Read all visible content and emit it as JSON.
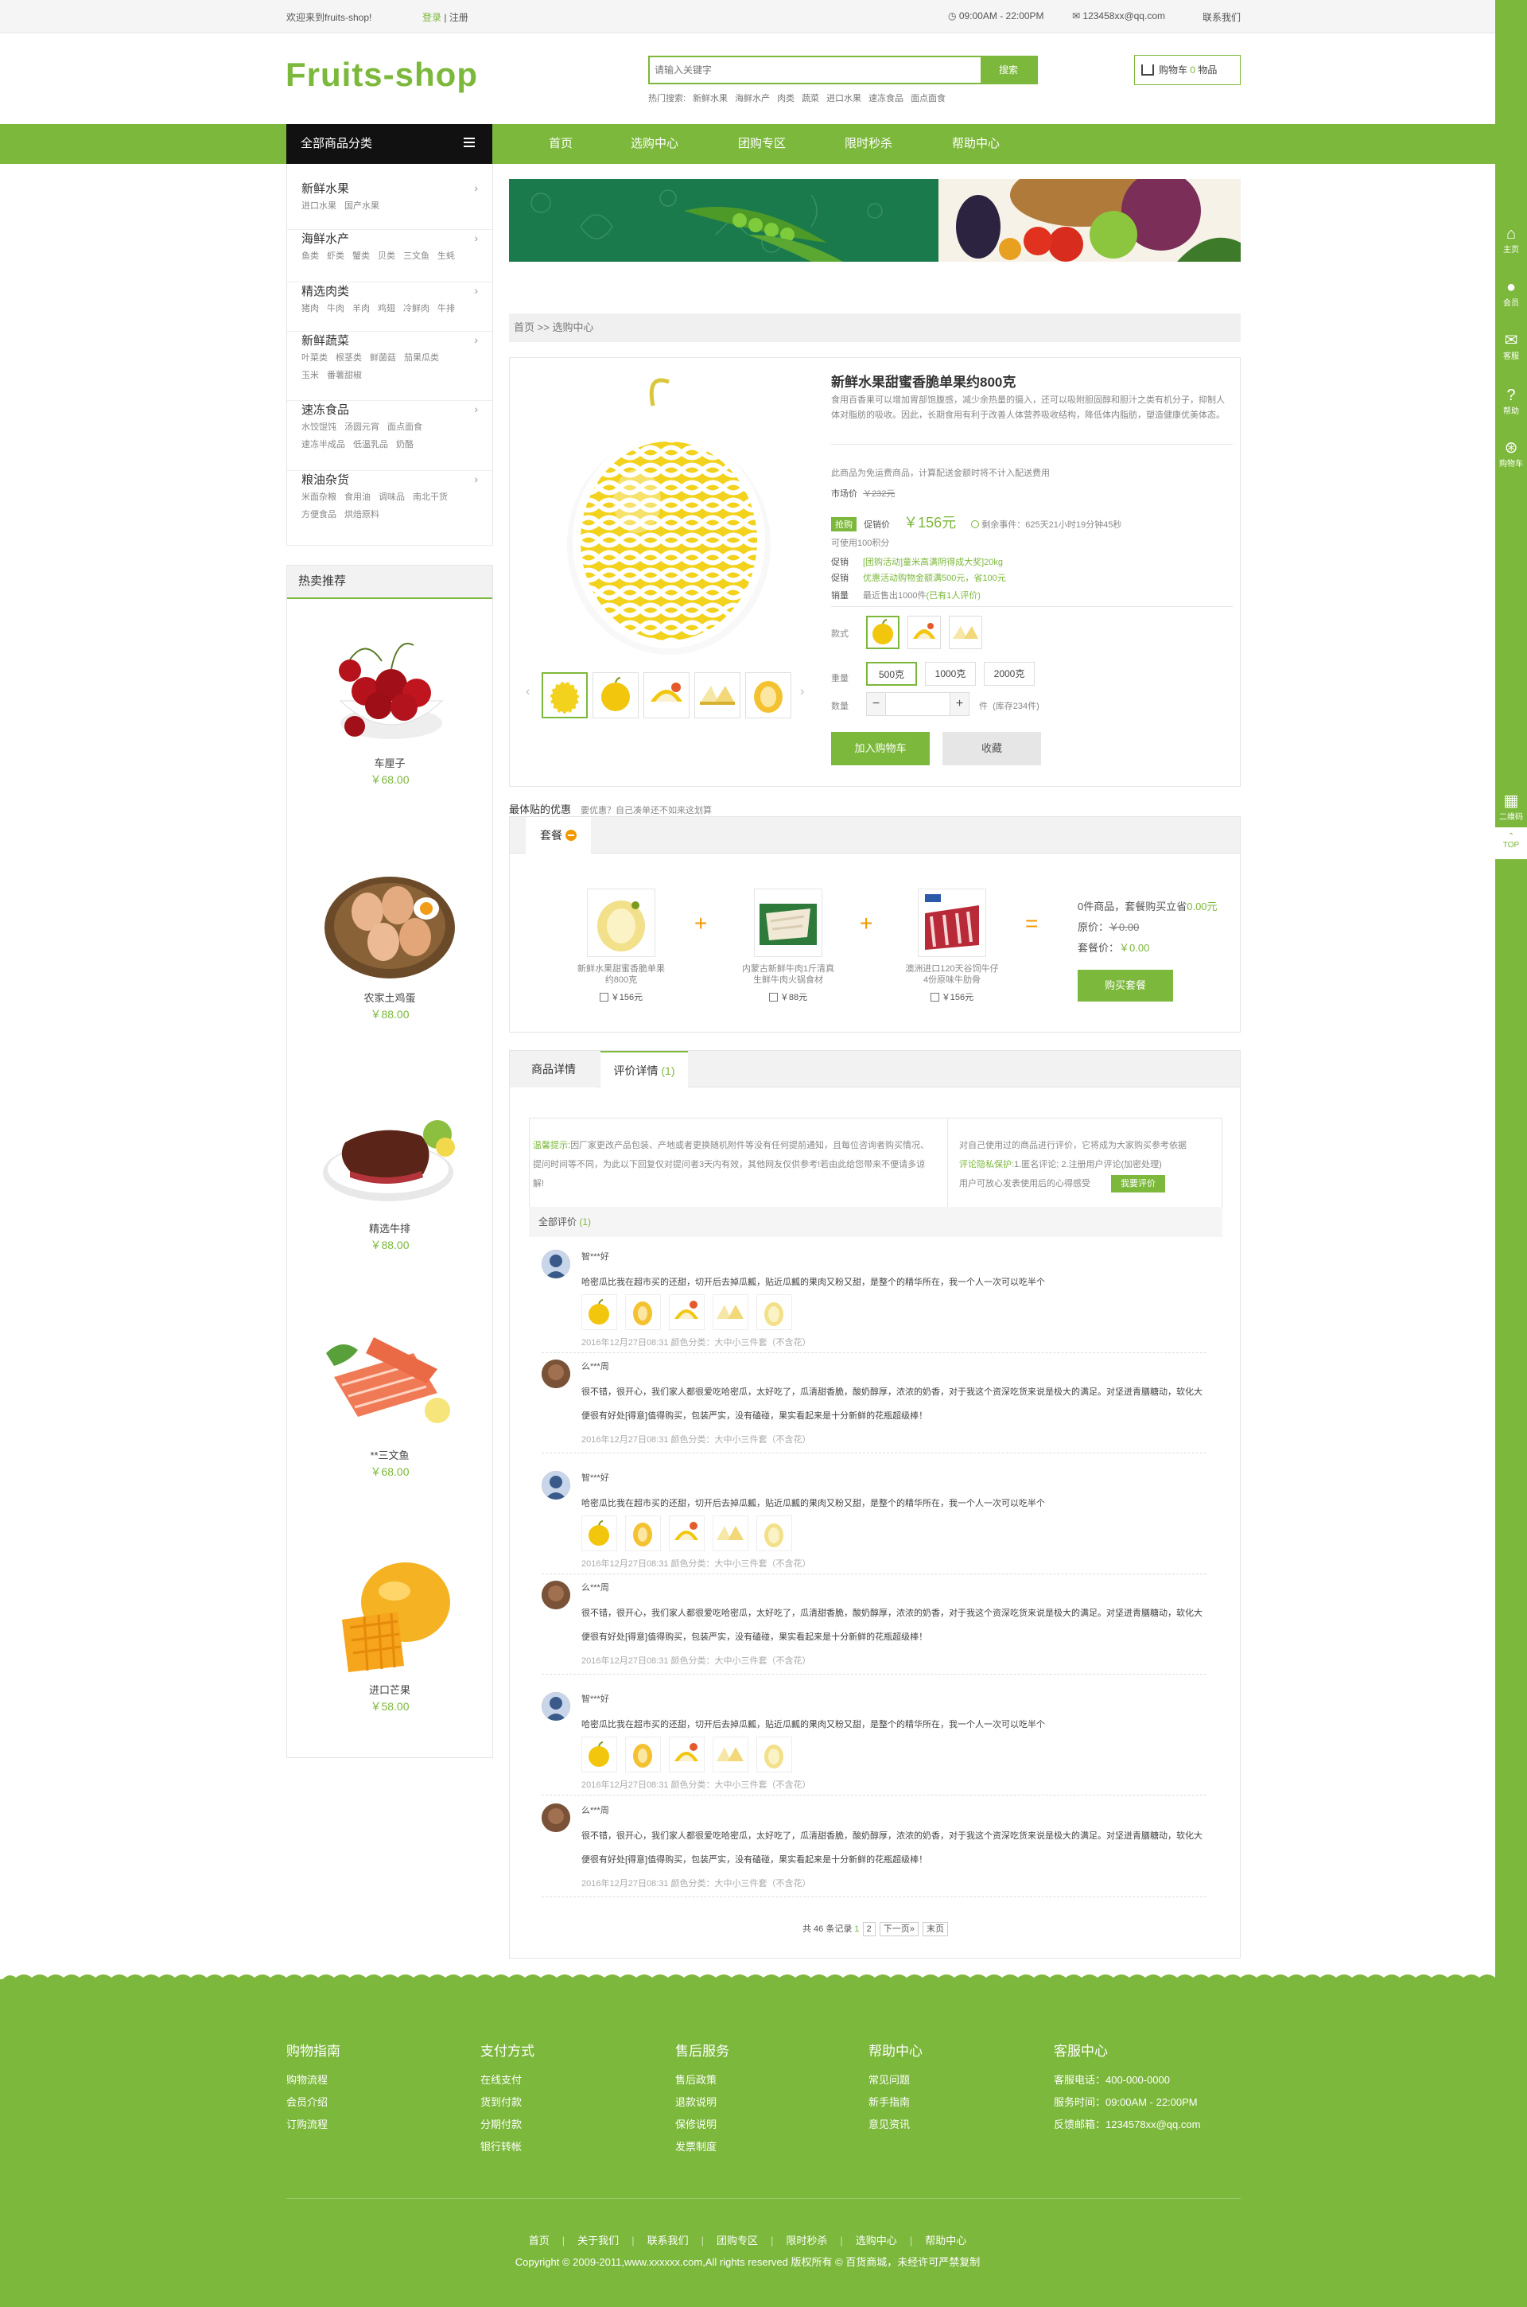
{
  "topbar": {
    "welcome": "欢迎来到fruits-shop!",
    "login": "登录",
    "register": "注册",
    "hours": "09:00AM - 22:00PM",
    "email": "123458xx@qq.com",
    "contact": "联系我们"
  },
  "header": {
    "logo": "Fruits-shop",
    "search_placeholder": "请输入关键字",
    "search_button": "搜索",
    "hot_label": "热门搜索:",
    "hot_words": [
      "新鲜水果",
      "海鲜水产",
      "肉类",
      "蔬菜",
      "进口水果",
      "速冻食品",
      "面点面食"
    ],
    "cart_label": "购物车",
    "cart_count": "0",
    "cart_unit": "物品"
  },
  "nav": {
    "category_label": "全部商品分类",
    "items": [
      "首页",
      "选购中心",
      "团购专区",
      "限时秒杀",
      "帮助中心"
    ]
  },
  "right_bar": {
    "items": [
      {
        "icon": "home-icon",
        "label": "主页"
      },
      {
        "icon": "user-icon",
        "label": "会员"
      },
      {
        "icon": "chat-icon",
        "label": "客服"
      },
      {
        "icon": "help-icon",
        "label": "帮助"
      },
      {
        "icon": "cart-icon",
        "label": "购物车"
      }
    ],
    "qr_label": "二维码",
    "top_label": "TOP"
  },
  "categories": [
    {
      "title": "新鲜水果",
      "subs": [
        [
          "进口水果",
          "国产水果"
        ]
      ]
    },
    {
      "title": "海鲜水产",
      "subs": [
        [
          "鱼类",
          "虾类",
          "蟹类",
          "贝类",
          "三文鱼",
          "生蚝"
        ]
      ]
    },
    {
      "title": "精选肉类",
      "subs": [
        [
          "猪肉",
          "牛肉",
          "羊肉",
          "鸡翅",
          "冷鲜肉",
          "牛排"
        ]
      ]
    },
    {
      "title": "新鲜蔬菜",
      "subs": [
        [
          "叶菜类",
          "根茎类",
          "鲜菌菇",
          "茄果瓜类"
        ],
        [
          "玉米",
          "番薯甜椒"
        ]
      ]
    },
    {
      "title": "速冻食品",
      "subs": [
        [
          "水饺馄饨",
          "汤圆元宵",
          "面点面食"
        ],
        [
          "速冻半成品",
          "低温乳品",
          "奶酪"
        ]
      ]
    },
    {
      "title": "粮油杂货",
      "subs": [
        [
          "米面杂粮",
          "食用油",
          "调味品",
          "南北干货"
        ],
        [
          "方便食品",
          "烘焙原料"
        ]
      ]
    }
  ],
  "hot": {
    "title": "热卖推荐",
    "items": [
      {
        "name": "车厘子",
        "price": "￥68.00"
      },
      {
        "name": "农家土鸡蛋",
        "price": "￥88.00"
      },
      {
        "name": "精选牛排",
        "price": "￥88.00"
      },
      {
        "name": "**三文鱼",
        "price": "￥68.00"
      },
      {
        "name": "进口芒果",
        "price": "￥58.00"
      }
    ]
  },
  "breadcrumb": {
    "home": "首页",
    "sep": ">>",
    "current": "选购中心"
  },
  "product": {
    "title": "新鲜水果甜蜜香脆单果约800克",
    "desc": "食用百香果可以增加胃部饱腹感，减少余热量的摄入，还可以吸附胆固醇和胆汁之类有机分子，抑制人体对脂肪的吸收。因此，长期食用有利于改善人体营养吸收结构，降低体内脂肪，塑造健康优美体态。",
    "notice": "此商品为免运费商品，计算配送金额时将不计入配送费用",
    "market_label": "市场价",
    "market_price": "￥232元",
    "buy_tag": "抢购",
    "promo_label": "促销价",
    "promo_price": "￥156元",
    "remaining": "剩余事件：625天21小时19分钟45秒",
    "coupon": "可使用100积分",
    "promos": [
      {
        "label": "促销",
        "text": "[团购活动]童米高满阴得成大奖]20kg"
      },
      {
        "label": "促销",
        "text": "优惠活动购物金额满500元，省100元"
      }
    ],
    "sales_label": "销量",
    "sales_text": "最近售出1000件",
    "sales_reviews": "(已有1人评价)",
    "style_label": "款式",
    "weight_label": "重量",
    "weights": [
      "500克",
      "1000克",
      "2000克"
    ],
    "qty_label": "数量",
    "qty_unit": "件",
    "stock": "(库存234件)",
    "add_cart": "加入购物车",
    "favorite": "收藏"
  },
  "combo": {
    "title": "最体贴的优惠",
    "subtitle": "要优惠？自己凑单还不如来这划算",
    "tab": "套餐",
    "items": [
      {
        "name": "新鲜水果甜蜜香脆单果约800克",
        "price": "￥156元"
      },
      {
        "name": "内蒙古新鲜牛肉1斤清真生鲜牛肉火锅食材",
        "price": "￥88元"
      },
      {
        "name": "澳洲进口120天谷饲牛仔4份原味牛肋骨",
        "price": "￥156元"
      }
    ],
    "sum_prefix": "0件商品，套餐购买立省",
    "sum_value": "0.00元",
    "orig_label": "原价：",
    "orig_value": "￥0.00",
    "combo_label": "套餐价：",
    "combo_value": "￥0.00",
    "buy": "购买套餐"
  },
  "detail": {
    "tab1": "商品详情",
    "tab2": "评价详情",
    "tab2_count": "(1)",
    "tip_title": "温馨提示:",
    "tip_text": "因厂家更改产品包装、产地或者更换随机附件等没有任何提前通知，且每位咨询者购买情况、提问时间等不同，为此以下回复仅对提问者3天内有效，其他网友仅供参考!若由此给您带来不便请多谅解!",
    "right_text": "对自己使用过的商品进行评价，它将成为大家购买参考依据",
    "protect_label": "评论隐私保护:",
    "protect_text": "1.匿名评论; 2.注册用户评论(加密处理)",
    "safe_text": "用户可放心发表使用后的心得感受",
    "review_btn": "我要评价",
    "all_label": "全部评价",
    "all_count": "(1)",
    "reviews": [
      {
        "user": "智***好",
        "text": "哈密瓜比我在超市买的还甜，切开后去掉瓜瓤，贴近瓜瓤的果肉又粉又甜，是整个的精华所在，我一个人一次可以吃半个",
        "meta": "2016年12月27日08:31    颜色分类：大中小三件套（不含花）",
        "pics": true
      },
      {
        "user": "么***周",
        "text": "很不错，很开心，我们家人都很爱吃哈密瓜，太好吃了，瓜清甜香脆，酸奶醇厚，浓浓的奶香，对于我这个资深吃货来说是极大的满足。对坚迸青膳糖动，软化大便很有好处[得意]值得购买，包装严实，没有磕碰，果实看起来是十分新鲜的花瓶超级棒！",
        "meta": "2016年12月27日08:31    颜色分类：大中小三件套（不含花）",
        "pics": false
      },
      {
        "user": "智***好",
        "text": "哈密瓜比我在超市买的还甜，切开后去掉瓜瓤，贴近瓜瓤的果肉又粉又甜，是整个的精华所在，我一个人一次可以吃半个",
        "meta": "2016年12月27日08:31    颜色分类：大中小三件套（不含花）",
        "pics": true
      },
      {
        "user": "么***周",
        "text": "很不错，很开心，我们家人都很爱吃哈密瓜，太好吃了，瓜清甜香脆，酸奶醇厚，浓浓的奶香，对于我这个资深吃货来说是极大的满足。对坚迸青膳糖动，软化大便很有好处[得意]值得购买，包装严实，没有磕碰，果实看起来是十分新鲜的花瓶超级棒！",
        "meta": "2016年12月27日08:31    颜色分类：大中小三件套（不含花）",
        "pics": false
      },
      {
        "user": "智***好",
        "text": "哈密瓜比我在超市买的还甜，切开后去掉瓜瓤，贴近瓜瓤的果肉又粉又甜，是整个的精华所在，我一个人一次可以吃半个",
        "meta": "2016年12月27日08:31    颜色分类：大中小三件套（不含花）",
        "pics": true
      },
      {
        "user": "么***周",
        "text": "很不错，很开心，我们家人都很爱吃哈密瓜，太好吃了，瓜清甜香脆，酸奶醇厚，浓浓的奶香，对于我这个资深吃货来说是极大的满足。对坚迸青膳糖动，软化大便很有好处[得意]值得购买，包装严实，没有磕碰，果实看起来是十分新鲜的花瓶超级棒！",
        "meta": "2016年12月27日08:31    颜色分类：大中小三件套（不含花）",
        "pics": false
      }
    ],
    "pager": {
      "total": "共 46 条记录",
      "p1": "1",
      "p2": "2",
      "next": "下一页»",
      "last": "末页"
    }
  },
  "footer": {
    "cols": [
      {
        "title": "购物指南",
        "links": [
          "购物流程",
          "会员介绍",
          "订购流程"
        ]
      },
      {
        "title": "支付方式",
        "links": [
          "在线支付",
          "货到付款",
          "分期付款",
          "银行转帐"
        ]
      },
      {
        "title": "售后服务",
        "links": [
          "售后政策",
          "退款说明",
          "保修说明",
          "发票制度"
        ]
      },
      {
        "title": "帮助中心",
        "links": [
          "常见问题",
          "新手指南",
          "意见资讯"
        ]
      },
      {
        "title": "客服中心",
        "links": [
          "客服电话：400-000-0000",
          "服务时间：09:00AM - 22:00PM",
          "反馈邮箱：1234578xx@qq.com"
        ]
      }
    ],
    "nav": [
      "首页",
      "关于我们",
      "联系我们",
      "团购专区",
      "限时秒杀",
      "选购中心",
      "帮助中心"
    ],
    "copyright": "Copyright © 2009-2011,www.xxxxxx.com,All rights reserved 版权所有 © 百货商城，未经许可严禁复制"
  },
  "colors": {
    "accent": "#7cb83b",
    "dark": "#111111",
    "orange": "#f39800"
  }
}
